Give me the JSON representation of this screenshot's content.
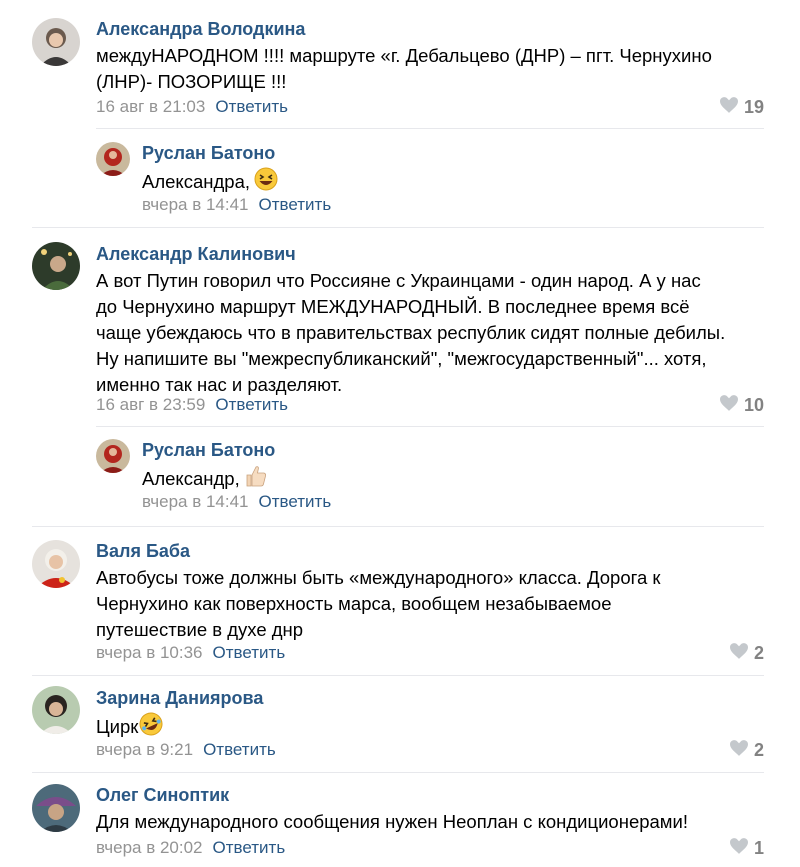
{
  "comments": [
    {
      "author": "Александра Володкина",
      "text": "междуНАРОДНОМ !!!! маршруте «г. Дебальцево (ДНР) – пгт. Чернухино\n(ЛНР)- ПОЗОРИЩЕ !!!",
      "date": "16 авг в 21:03",
      "reply": "Ответить",
      "likes": "19",
      "replies": [
        {
          "author": "Руслан Батоно",
          "text": "Александра,",
          "emoji": "laughing-emoji",
          "date": "вчера в 14:41",
          "reply": "Ответить"
        }
      ]
    },
    {
      "author": "Александр Калинович",
      "text": "А вот Путин говорил что Россияне с Украинцами - один народ. А у нас\nдо Чернухино маршрут МЕЖДУНАРОДНЫЙ. В последнее время всё\nчаще убеждаюсь что в правительствах республик сидят полные дебилы.\nНу напишите вы \"межреспубликанский\", \"межгосударственный\"... хотя,\nименно так нас и разделяют.",
      "date": "16 авг в 23:59",
      "reply": "Ответить",
      "likes": "10",
      "replies": [
        {
          "author": "Руслан Батоно",
          "text": "Александр,",
          "emoji": "thumbs-up-emoji",
          "date": "вчера в 14:41",
          "reply": "Ответить"
        }
      ]
    },
    {
      "author": "Валя Баба",
      "text": "Автобусы тоже должны быть «международного» класса. Дорога к\nЧернухино как поверхность марса, вообщем незабываемое\nпутешествие в духе днр",
      "date": "вчера в 10:36",
      "reply": "Ответить",
      "likes": "2"
    },
    {
      "author": "Зарина Даниярова",
      "text": "Цирк",
      "emoji": "rofl-emoji",
      "date": "вчера в 9:21",
      "reply": "Ответить",
      "likes": "2"
    },
    {
      "author": "Олег Синоптик",
      "text": "Для международного сообщения нужен Неоплан с кондиционерами!",
      "date": "вчера в 20:02",
      "reply": "Ответить",
      "likes": "1"
    }
  ],
  "icons": {
    "like": "heart-icon"
  },
  "colors": {
    "author": "#2a5885",
    "meta": "#939393",
    "likes": "#828282",
    "separator": "#e7e8ec"
  }
}
